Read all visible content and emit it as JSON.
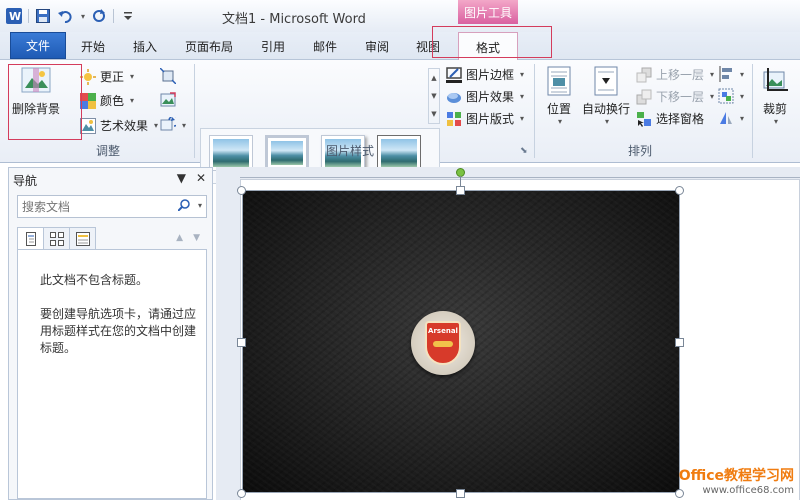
{
  "window": {
    "title": "文档1 - Microsoft Word",
    "context_tab_header": "图片工具"
  },
  "tabs": {
    "file": "文件",
    "home": "开始",
    "insert": "插入",
    "page_layout": "页面布局",
    "references": "引用",
    "mailings": "邮件",
    "review": "审阅",
    "view": "视图",
    "format": "格式"
  },
  "ribbon": {
    "adjust": {
      "remove_background": "删除背景",
      "corrections": "更正",
      "color": "颜色",
      "artistic_effects": "艺术效果",
      "label": "调整"
    },
    "picture_styles": {
      "border": "图片边框",
      "effects": "图片效果",
      "layout": "图片版式",
      "label": "图片样式"
    },
    "arrange": {
      "position": "位置",
      "wrap_text": "自动换行",
      "bring_forward": "上移一层",
      "send_backward": "下移一层",
      "selection_pane": "选择窗格",
      "label": "排列"
    },
    "size": {
      "crop": "裁剪"
    }
  },
  "nav": {
    "title": "导航",
    "search_placeholder": "搜索文档",
    "message1": "此文档不包含标题。",
    "message2": "要创建导航选项卡，请通过应用标题样式在您的文档中创建标题。"
  },
  "picture": {
    "badge_text": "Arsenal"
  },
  "watermark": {
    "brand": "Office教程学习网",
    "url": "www.office68.com"
  },
  "colors": {
    "accent": "#2b5fb4",
    "context_tab": "#d960a0",
    "highlight_box": "#d43c5c"
  }
}
